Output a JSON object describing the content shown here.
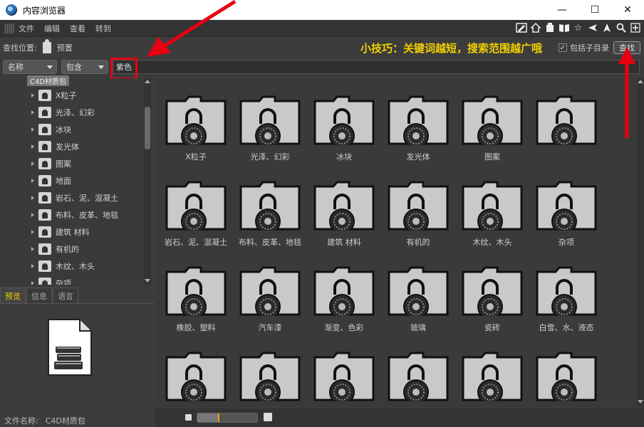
{
  "window": {
    "title": "内容浏览器",
    "controls": {
      "minimize": "—",
      "maximize": "☐",
      "close": "✕"
    }
  },
  "menu": [
    "文件",
    "编辑",
    "查看",
    "转到"
  ],
  "toolbar_icons": [
    "edit-icon",
    "home-icon",
    "disk-icon",
    "book-icon",
    "star-icon",
    "back-icon",
    "up-arrow-icon",
    "search-icon",
    "add-icon"
  ],
  "location": {
    "label": "查找位置:",
    "value": "预置"
  },
  "tip": "小技巧：关键词越短，搜索范围越广哦",
  "subdir": {
    "label": "包括子目录",
    "checked": true
  },
  "find_button": "查找",
  "filter": {
    "field": "名称",
    "mode": "包含",
    "query": "紫色"
  },
  "tree": {
    "root": "C4D材质包",
    "items": [
      "X粒子",
      "光泽、幻彩",
      "冰块",
      "发光体",
      "图案",
      "地面",
      "岩石、泥、混凝土",
      "布料、皮革、地毯",
      "建筑 材料",
      "有机的",
      "木纹、木头",
      "杂项"
    ]
  },
  "preview": {
    "tabs": [
      "预览",
      "信息",
      "语言"
    ],
    "active_tab": "预览",
    "file_label": "文件名称:",
    "file_name": "C4D材质包"
  },
  "grid": {
    "rows": [
      [
        "X粒子",
        "光泽、幻彩",
        "冰块",
        "发光体",
        "图案",
        ""
      ],
      [
        "岩石、泥、混凝土",
        "布料、皮革、地毯",
        "建筑 材料",
        "有机的",
        "木纹、木头",
        "杂项"
      ],
      [
        "橡胶、塑料",
        "汽车漆",
        "渐变、色彩",
        "玻璃",
        "瓷砖",
        "白雪、水、液态"
      ],
      [
        "",
        "",
        "",
        "",
        "",
        ""
      ]
    ]
  },
  "zoom": 0.35,
  "colors": {
    "tip": "#f0d000",
    "annotation": "#e60012",
    "active_tab": "#f0d000"
  }
}
